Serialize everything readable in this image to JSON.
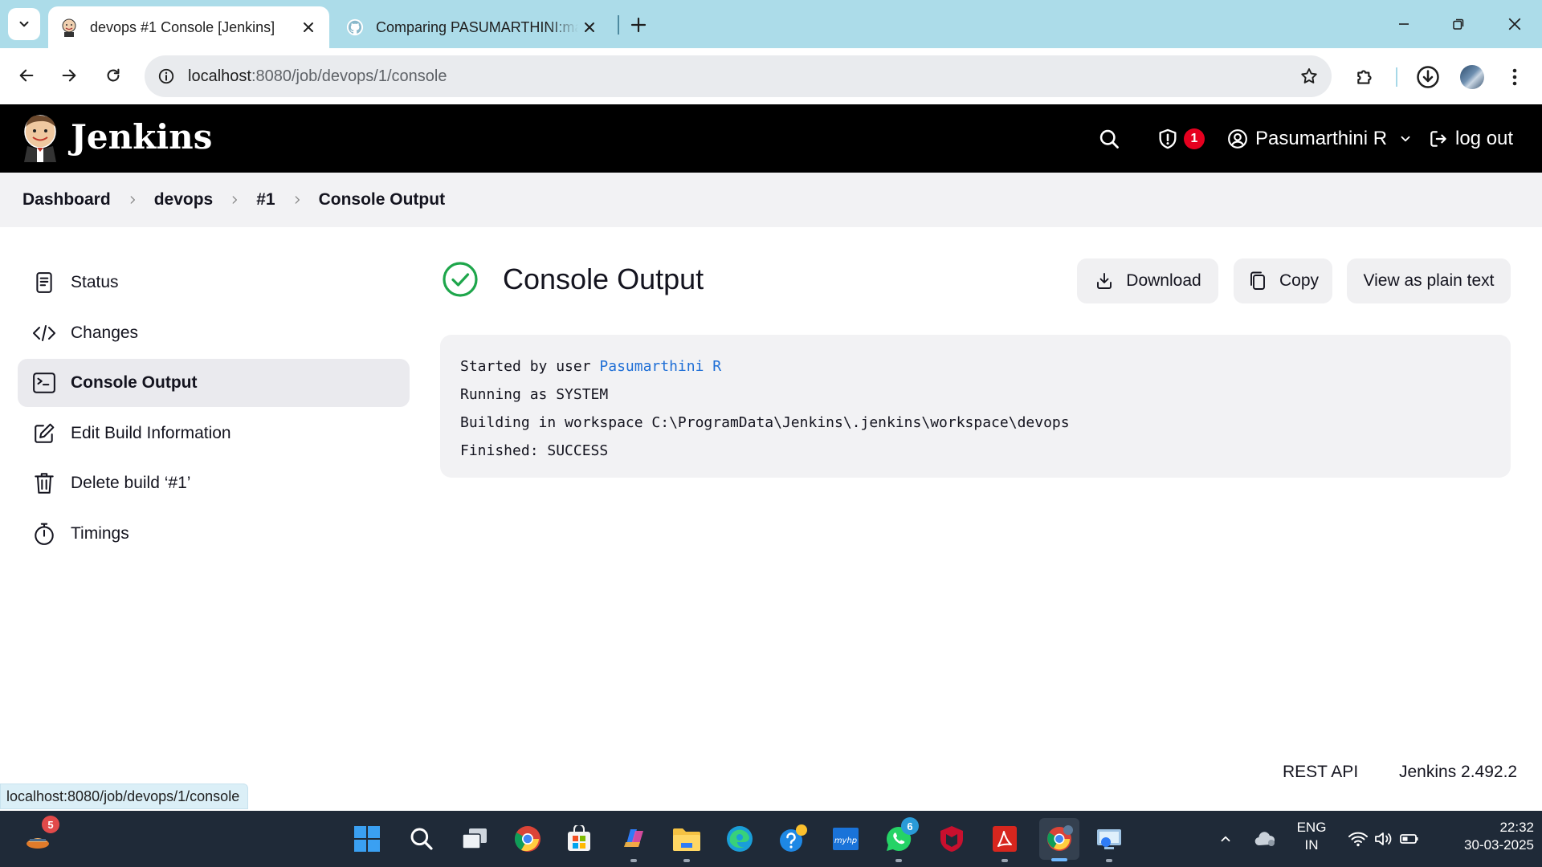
{
  "browser": {
    "tabs": [
      {
        "title": "devops #1 Console [Jenkins]",
        "active": true
      },
      {
        "title": "Comparing PASUMARTHINI:main",
        "active": false
      }
    ],
    "url_host": "localhost",
    "url_rest": ":8080/job/devops/1/console",
    "status_url": "localhost:8080/job/devops/1/console"
  },
  "header": {
    "brand": "Jenkins",
    "security_count": "1",
    "user_name": "Pasumarthini R",
    "logout_label": "log out"
  },
  "breadcrumb": [
    "Dashboard",
    "devops",
    "#1",
    "Console Output"
  ],
  "sidebar": {
    "items": [
      {
        "label": "Status",
        "icon": "document-icon"
      },
      {
        "label": "Changes",
        "icon": "code-icon"
      },
      {
        "label": "Console Output",
        "icon": "terminal-icon",
        "active": true
      },
      {
        "label": "Edit Build Information",
        "icon": "edit-icon"
      },
      {
        "label": "Delete build ‘#1’",
        "icon": "trash-icon"
      },
      {
        "label": "Timings",
        "icon": "stopwatch-icon"
      }
    ]
  },
  "main": {
    "title": "Console Output",
    "status": "success",
    "actions": {
      "download": "Download",
      "copy": "Copy",
      "plain": "View as plain text"
    },
    "console": {
      "line1_prefix": "Started by user ",
      "line1_user": "Pasumarthini R",
      "line2": "Running as SYSTEM",
      "line3": "Building in workspace C:\\ProgramData\\Jenkins\\.jenkins\\workspace\\devops",
      "line4": "Finished: SUCCESS"
    }
  },
  "footer": {
    "rest_api": "REST API",
    "version": "Jenkins 2.492.2"
  },
  "taskbar": {
    "notification_badge": "5",
    "whatsapp_badge": "6",
    "lang_top": "ENG",
    "lang_bottom": "IN",
    "time": "22:32",
    "date": "30-03-2025"
  },
  "colors": {
    "success": "#1ea64b",
    "link": "#1f6fd6",
    "header_bg": "#000000",
    "tabstrip_bg": "#acdce9"
  }
}
